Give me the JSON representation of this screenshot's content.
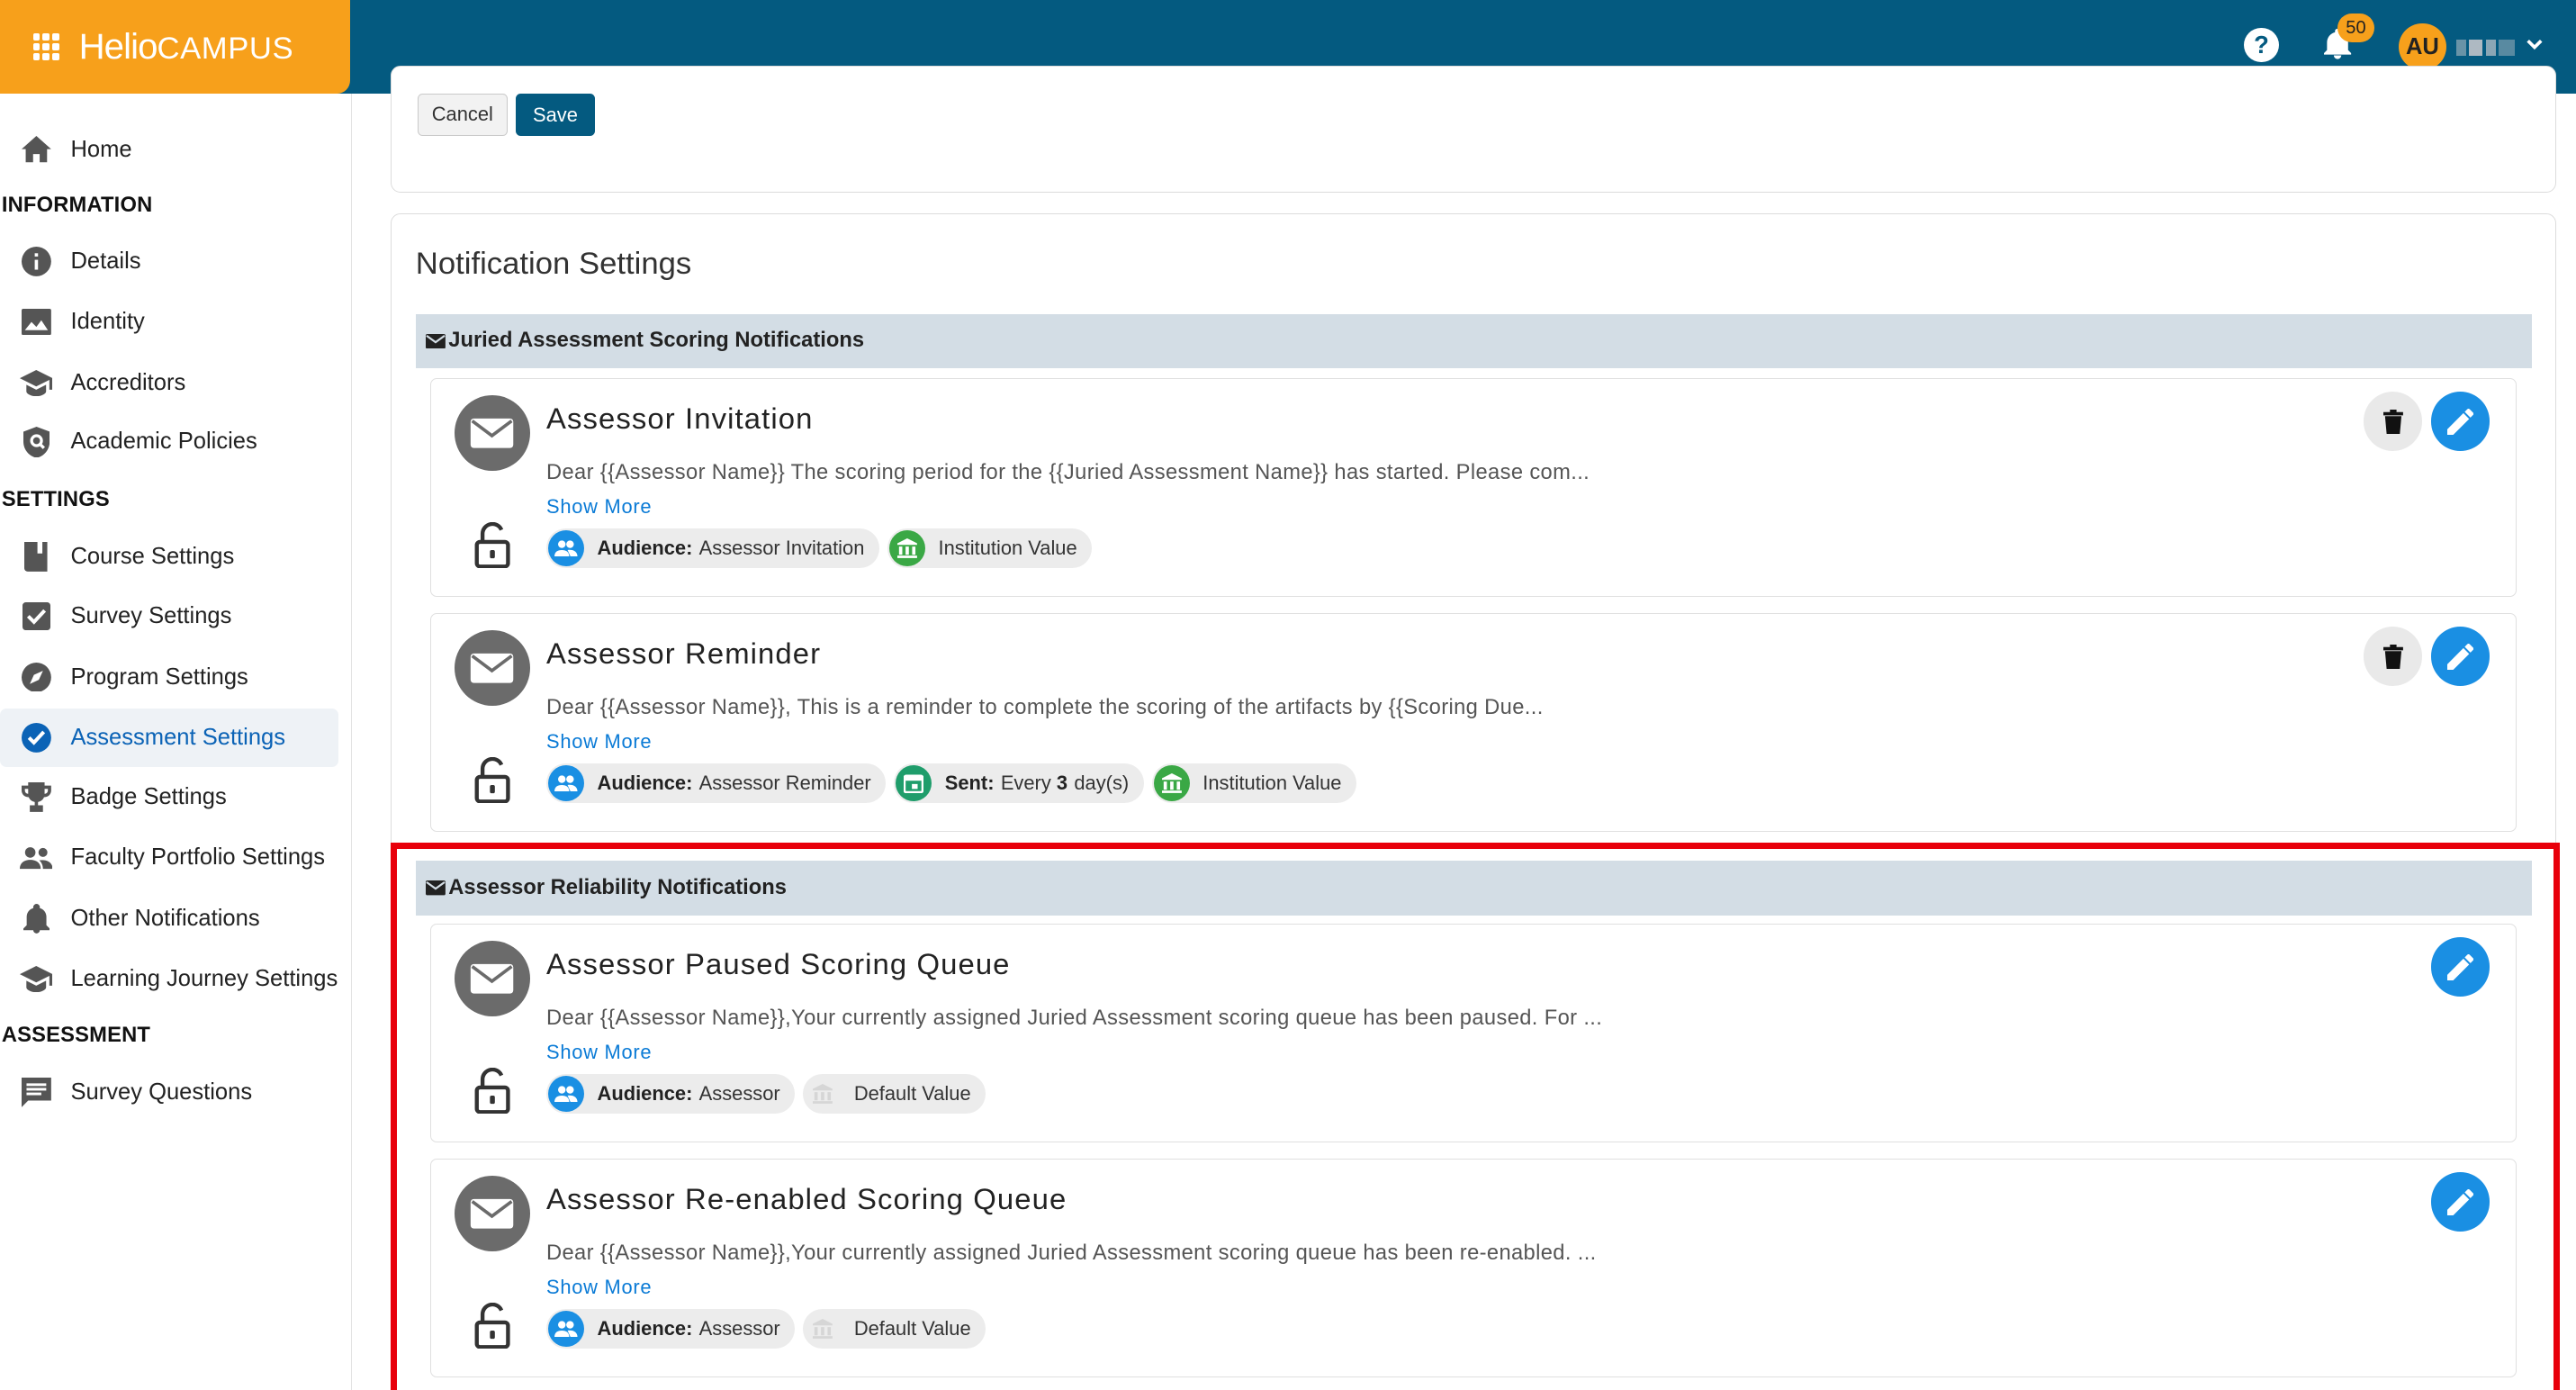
{
  "topbar": {
    "logo_primary": "Helio",
    "logo_secondary": "CAMPUS",
    "help_symbol": "?",
    "notifications_count": "50",
    "avatar_initials": "AU"
  },
  "sidebar": {
    "home": "Home",
    "sections": [
      {
        "heading": "INFORMATION",
        "items": [
          "Details",
          "Identity",
          "Accreditors",
          "Academic Policies"
        ]
      },
      {
        "heading": "SETTINGS",
        "items": [
          "Course Settings",
          "Survey Settings",
          "Program Settings",
          "Assessment Settings",
          "Badge Settings",
          "Faculty Portfolio Settings",
          "Other Notifications",
          "Learning Journey Settings"
        ]
      },
      {
        "heading": "ASSESSMENT",
        "items": [
          "Survey Questions"
        ]
      }
    ],
    "active_item": "Assessment Settings"
  },
  "form_actions": {
    "cancel": "Cancel",
    "save": "Save"
  },
  "notification_settings": {
    "title": "Notification Settings",
    "groups": [
      {
        "title": "Juried Assessment Scoring Notifications",
        "items": [
          {
            "title": "Assessor Invitation",
            "description": "Dear {{Assessor Name}} The scoring period for the {{Juried Assessment Name}} has started. Please com...",
            "show_more": "Show More",
            "audience_label": "Audience:",
            "audience": "Assessor Invitation",
            "value_label": "Institution Value"
          },
          {
            "title": "Assessor Reminder",
            "description": "Dear {{Assessor Name}}, This is a reminder to complete the scoring of the artifacts by {{Scoring Due...",
            "show_more": "Show More",
            "audience_label": "Audience:",
            "audience": "Assessor Reminder",
            "sent_label": "Sent:",
            "sent_prefix": "Every",
            "sent_value": "3",
            "sent_suffix": "day(s)",
            "value_label": "Institution Value"
          }
        ]
      },
      {
        "title": "Assessor Reliability Notifications",
        "items": [
          {
            "title": "Assessor Paused Scoring Queue",
            "description": "Dear {{Assessor Name}},Your currently assigned Juried Assessment scoring queue has been paused. For ...",
            "show_more": "Show More",
            "audience_label": "Audience:",
            "audience": "Assessor",
            "value_label": "Default Value"
          },
          {
            "title": "Assessor Re-enabled Scoring Queue",
            "description": "Dear {{Assessor Name}},Your currently assigned Juried Assessment scoring queue has been re-enabled. ...",
            "show_more": "Show More",
            "audience_label": "Audience:",
            "audience": "Assessor",
            "value_label": "Default Value"
          }
        ]
      }
    ]
  },
  "colors": {
    "topbar": "#045a80",
    "brand": "#f7a01b",
    "highlight_box": "#e8000b",
    "edit_button": "#1a8fe3",
    "institution_chip_icon": "#3aa845"
  }
}
